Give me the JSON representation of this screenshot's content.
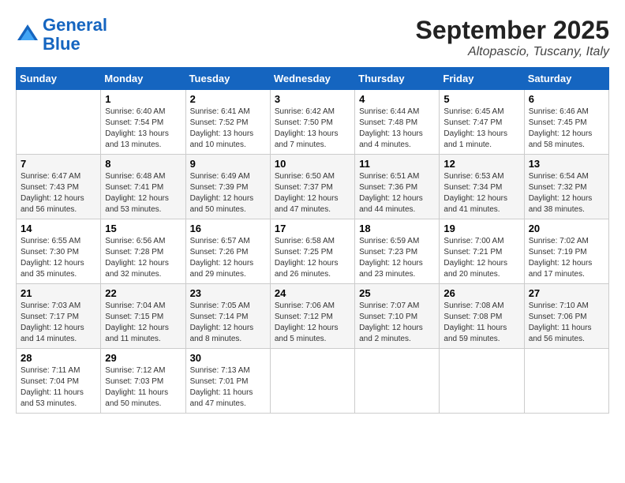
{
  "logo": {
    "line1": "General",
    "line2": "Blue"
  },
  "title": "September 2025",
  "location": "Altopascio, Tuscany, Italy",
  "weekdays": [
    "Sunday",
    "Monday",
    "Tuesday",
    "Wednesday",
    "Thursday",
    "Friday",
    "Saturday"
  ],
  "weeks": [
    [
      {
        "day": "",
        "sunrise": "",
        "sunset": "",
        "daylight": ""
      },
      {
        "day": "1",
        "sunrise": "Sunrise: 6:40 AM",
        "sunset": "Sunset: 7:54 PM",
        "daylight": "Daylight: 13 hours and 13 minutes."
      },
      {
        "day": "2",
        "sunrise": "Sunrise: 6:41 AM",
        "sunset": "Sunset: 7:52 PM",
        "daylight": "Daylight: 13 hours and 10 minutes."
      },
      {
        "day": "3",
        "sunrise": "Sunrise: 6:42 AM",
        "sunset": "Sunset: 7:50 PM",
        "daylight": "Daylight: 13 hours and 7 minutes."
      },
      {
        "day": "4",
        "sunrise": "Sunrise: 6:44 AM",
        "sunset": "Sunset: 7:48 PM",
        "daylight": "Daylight: 13 hours and 4 minutes."
      },
      {
        "day": "5",
        "sunrise": "Sunrise: 6:45 AM",
        "sunset": "Sunset: 7:47 PM",
        "daylight": "Daylight: 13 hours and 1 minute."
      },
      {
        "day": "6",
        "sunrise": "Sunrise: 6:46 AM",
        "sunset": "Sunset: 7:45 PM",
        "daylight": "Daylight: 12 hours and 58 minutes."
      }
    ],
    [
      {
        "day": "7",
        "sunrise": "Sunrise: 6:47 AM",
        "sunset": "Sunset: 7:43 PM",
        "daylight": "Daylight: 12 hours and 56 minutes."
      },
      {
        "day": "8",
        "sunrise": "Sunrise: 6:48 AM",
        "sunset": "Sunset: 7:41 PM",
        "daylight": "Daylight: 12 hours and 53 minutes."
      },
      {
        "day": "9",
        "sunrise": "Sunrise: 6:49 AM",
        "sunset": "Sunset: 7:39 PM",
        "daylight": "Daylight: 12 hours and 50 minutes."
      },
      {
        "day": "10",
        "sunrise": "Sunrise: 6:50 AM",
        "sunset": "Sunset: 7:37 PM",
        "daylight": "Daylight: 12 hours and 47 minutes."
      },
      {
        "day": "11",
        "sunrise": "Sunrise: 6:51 AM",
        "sunset": "Sunset: 7:36 PM",
        "daylight": "Daylight: 12 hours and 44 minutes."
      },
      {
        "day": "12",
        "sunrise": "Sunrise: 6:53 AM",
        "sunset": "Sunset: 7:34 PM",
        "daylight": "Daylight: 12 hours and 41 minutes."
      },
      {
        "day": "13",
        "sunrise": "Sunrise: 6:54 AM",
        "sunset": "Sunset: 7:32 PM",
        "daylight": "Daylight: 12 hours and 38 minutes."
      }
    ],
    [
      {
        "day": "14",
        "sunrise": "Sunrise: 6:55 AM",
        "sunset": "Sunset: 7:30 PM",
        "daylight": "Daylight: 12 hours and 35 minutes."
      },
      {
        "day": "15",
        "sunrise": "Sunrise: 6:56 AM",
        "sunset": "Sunset: 7:28 PM",
        "daylight": "Daylight: 12 hours and 32 minutes."
      },
      {
        "day": "16",
        "sunrise": "Sunrise: 6:57 AM",
        "sunset": "Sunset: 7:26 PM",
        "daylight": "Daylight: 12 hours and 29 minutes."
      },
      {
        "day": "17",
        "sunrise": "Sunrise: 6:58 AM",
        "sunset": "Sunset: 7:25 PM",
        "daylight": "Daylight: 12 hours and 26 minutes."
      },
      {
        "day": "18",
        "sunrise": "Sunrise: 6:59 AM",
        "sunset": "Sunset: 7:23 PM",
        "daylight": "Daylight: 12 hours and 23 minutes."
      },
      {
        "day": "19",
        "sunrise": "Sunrise: 7:00 AM",
        "sunset": "Sunset: 7:21 PM",
        "daylight": "Daylight: 12 hours and 20 minutes."
      },
      {
        "day": "20",
        "sunrise": "Sunrise: 7:02 AM",
        "sunset": "Sunset: 7:19 PM",
        "daylight": "Daylight: 12 hours and 17 minutes."
      }
    ],
    [
      {
        "day": "21",
        "sunrise": "Sunrise: 7:03 AM",
        "sunset": "Sunset: 7:17 PM",
        "daylight": "Daylight: 12 hours and 14 minutes."
      },
      {
        "day": "22",
        "sunrise": "Sunrise: 7:04 AM",
        "sunset": "Sunset: 7:15 PM",
        "daylight": "Daylight: 12 hours and 11 minutes."
      },
      {
        "day": "23",
        "sunrise": "Sunrise: 7:05 AM",
        "sunset": "Sunset: 7:14 PM",
        "daylight": "Daylight: 12 hours and 8 minutes."
      },
      {
        "day": "24",
        "sunrise": "Sunrise: 7:06 AM",
        "sunset": "Sunset: 7:12 PM",
        "daylight": "Daylight: 12 hours and 5 minutes."
      },
      {
        "day": "25",
        "sunrise": "Sunrise: 7:07 AM",
        "sunset": "Sunset: 7:10 PM",
        "daylight": "Daylight: 12 hours and 2 minutes."
      },
      {
        "day": "26",
        "sunrise": "Sunrise: 7:08 AM",
        "sunset": "Sunset: 7:08 PM",
        "daylight": "Daylight: 11 hours and 59 minutes."
      },
      {
        "day": "27",
        "sunrise": "Sunrise: 7:10 AM",
        "sunset": "Sunset: 7:06 PM",
        "daylight": "Daylight: 11 hours and 56 minutes."
      }
    ],
    [
      {
        "day": "28",
        "sunrise": "Sunrise: 7:11 AM",
        "sunset": "Sunset: 7:04 PM",
        "daylight": "Daylight: 11 hours and 53 minutes."
      },
      {
        "day": "29",
        "sunrise": "Sunrise: 7:12 AM",
        "sunset": "Sunset: 7:03 PM",
        "daylight": "Daylight: 11 hours and 50 minutes."
      },
      {
        "day": "30",
        "sunrise": "Sunrise: 7:13 AM",
        "sunset": "Sunset: 7:01 PM",
        "daylight": "Daylight: 11 hours and 47 minutes."
      },
      {
        "day": "",
        "sunrise": "",
        "sunset": "",
        "daylight": ""
      },
      {
        "day": "",
        "sunrise": "",
        "sunset": "",
        "daylight": ""
      },
      {
        "day": "",
        "sunrise": "",
        "sunset": "",
        "daylight": ""
      },
      {
        "day": "",
        "sunrise": "",
        "sunset": "",
        "daylight": ""
      }
    ]
  ]
}
